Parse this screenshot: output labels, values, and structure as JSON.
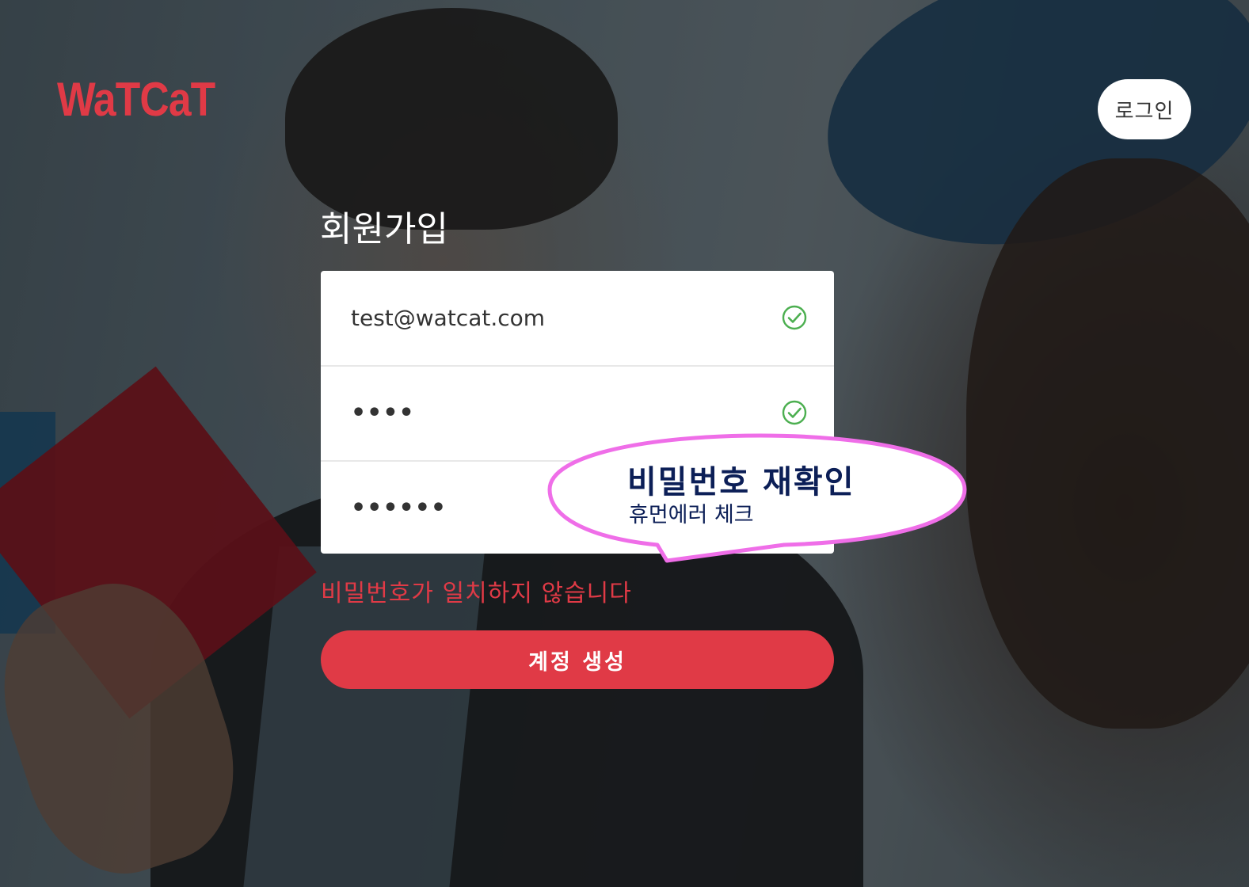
{
  "app": {
    "logo_text": "WaTCaT",
    "login_label": "로그인"
  },
  "signup": {
    "title": "회원가입",
    "fields": [
      {
        "name": "email",
        "value": "test@watcat.com",
        "status": "valid",
        "icon": "check-circle-icon"
      },
      {
        "name": "password",
        "value": "••••",
        "status": "valid",
        "icon": "check-circle-icon"
      },
      {
        "name": "password-confirm",
        "value": "••••••",
        "status": "mismatch"
      }
    ],
    "error_message": "비밀번호가 일치하지 않습니다",
    "submit_label": "계정 생성"
  },
  "callout": {
    "title": "비밀번호 재확인",
    "subtitle": "휴먼에러 체크"
  },
  "colors": {
    "brand_red": "#e03a46",
    "valid_green": "#4caf50",
    "callout_border": "#ef6ee8",
    "callout_text": "#0c1f57"
  }
}
